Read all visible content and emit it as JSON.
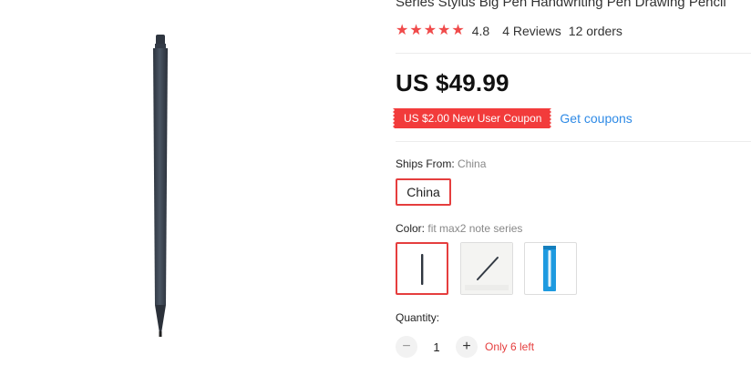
{
  "product": {
    "title": "Series Stylus Big Pen Handwriting Pen Drawing Pencil",
    "rating": "4.8",
    "stars_filled": 5,
    "reviews": "4 Reviews",
    "orders": "12 orders",
    "price": "US $49.99",
    "coupon_text": "US $2.00 New User Coupon",
    "get_coupons": "Get coupons"
  },
  "shipping": {
    "label": "Ships From:",
    "value": "China",
    "option": "China"
  },
  "color": {
    "label": "Color:",
    "value": "fit max2 note series"
  },
  "quantity": {
    "label": "Quantity:",
    "minus": "−",
    "value": "1",
    "plus": "+",
    "stock": "Only 6 left"
  },
  "colors": {
    "accent_red": "#e53e3e",
    "link_blue": "#2e8ae6",
    "stylus_body": "#3a4452",
    "swatch_blue": "#1e9ae0"
  },
  "icons": {
    "star": "star-icon",
    "minus": "minus-icon",
    "plus": "plus-icon"
  }
}
